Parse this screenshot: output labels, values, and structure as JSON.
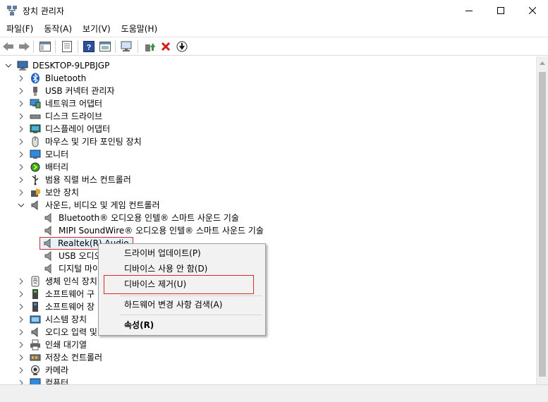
{
  "window": {
    "title": "장치 관리자",
    "min_icon": "minimize-icon",
    "max_icon": "maximize-icon",
    "close_icon": "close-icon"
  },
  "menu": [
    "파일(F)",
    "동작(A)",
    "보기(V)",
    "도움말(H)"
  ],
  "toolbar": {
    "icons": [
      "back-arrow-icon",
      "forward-arrow-icon",
      "show-hide-console-tree-icon",
      "properties-icon",
      "help-icon",
      "view-icon",
      "scan-hardware-icon",
      "update-driver-icon",
      "uninstall-device-icon",
      "download-icon"
    ]
  },
  "tree": {
    "root": "DESKTOP-9LPBJGP",
    "items": [
      {
        "label": "Bluetooth",
        "icon": "bluetooth-icon"
      },
      {
        "label": "USB 커넥터 관리자",
        "icon": "usb-icon"
      },
      {
        "label": "네트워크 어댑터",
        "icon": "network-adapter-icon"
      },
      {
        "label": "디스크 드라이브",
        "icon": "disk-drive-icon"
      },
      {
        "label": "디스플레이 어댑터",
        "icon": "display-adapter-icon"
      },
      {
        "label": "마우스 및 기타 포인팅 장치",
        "icon": "mouse-icon"
      },
      {
        "label": "모니터",
        "icon": "monitor-icon"
      },
      {
        "label": "배터리",
        "icon": "battery-icon"
      },
      {
        "label": "범용 직렬 버스 컨트롤러",
        "icon": "usb-controller-icon"
      },
      {
        "label": "보안 장치",
        "icon": "security-device-icon"
      },
      {
        "label": "사운드, 비디오 및 게임 컨트롤러",
        "icon": "speaker-icon"
      }
    ],
    "sound_children": [
      {
        "label": "Bluetooth® 오디오용 인텔® 스마트 사운드 기술",
        "icon": "speaker-icon"
      },
      {
        "label": "MIPI SoundWire® 오디오용 인텔® 스마트 사운드 기술",
        "icon": "speaker-icon"
      },
      {
        "label": "Realtek(R) Audio",
        "icon": "speaker-icon"
      },
      {
        "label": "USB 오디오",
        "icon": "speaker-icon"
      },
      {
        "label": "디지털 마이",
        "icon": "speaker-icon"
      }
    ],
    "after_items": [
      {
        "label": "생체 인식 장치",
        "icon": "fingerprint-icon"
      },
      {
        "label": "소프트웨어 구",
        "icon": "software-component-icon"
      },
      {
        "label": "소프트웨어 장",
        "icon": "software-device-icon"
      },
      {
        "label": "시스템 장치",
        "icon": "system-device-icon"
      },
      {
        "label": "오디오 입력 및",
        "icon": "audio-input-icon"
      },
      {
        "label": "인쇄 대기열",
        "icon": "printer-icon"
      },
      {
        "label": "저장소 컨트롤러",
        "icon": "storage-controller-icon"
      },
      {
        "label": "카메라",
        "icon": "camera-icon"
      },
      {
        "label": "컴퓨터",
        "icon": "computer-icon"
      }
    ]
  },
  "context_menu": {
    "update_driver": "드라이버 업데이트(P)",
    "disable_device": "디바이스 사용 안 함(D)",
    "uninstall_device": "디바이스 제거(U)",
    "scan_hardware": "하드웨어 변경 사항 검색(A)",
    "properties": "속성(R)"
  },
  "colors": {
    "highlight_border": "#d42b2b",
    "selection_bg": "#e5f1fb"
  }
}
